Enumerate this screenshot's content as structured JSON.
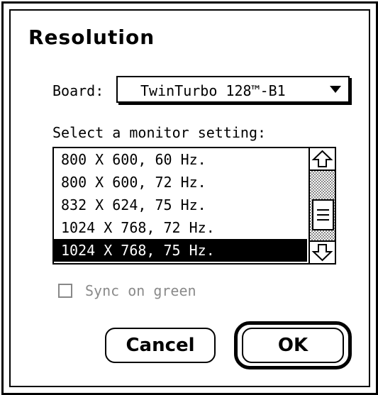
{
  "dialog": {
    "title": "Resolution"
  },
  "board": {
    "label": "Board:",
    "selected": "TwinTurbo 128™-B1",
    "dropdown_icon": "triangle-down-icon"
  },
  "monitor": {
    "label": "Select a monitor setting:",
    "options": [
      "800 X 600, 60 Hz.",
      "800 X 600, 72 Hz.",
      "832 X 624, 75 Hz.",
      "1024 X 768, 72 Hz.",
      "1024 X 768, 75 Hz."
    ],
    "selected_index": 4,
    "scroll_up_icon": "arrow-up-icon",
    "scroll_down_icon": "arrow-down-icon"
  },
  "sync_on_green": {
    "label": "Sync on green",
    "checked": false,
    "enabled": false
  },
  "buttons": {
    "cancel_label": "Cancel",
    "ok_label": "OK"
  },
  "colors": {
    "selection_background": "#000000",
    "selection_text": "#ffffff",
    "disabled_text": "#8a8a8a"
  }
}
